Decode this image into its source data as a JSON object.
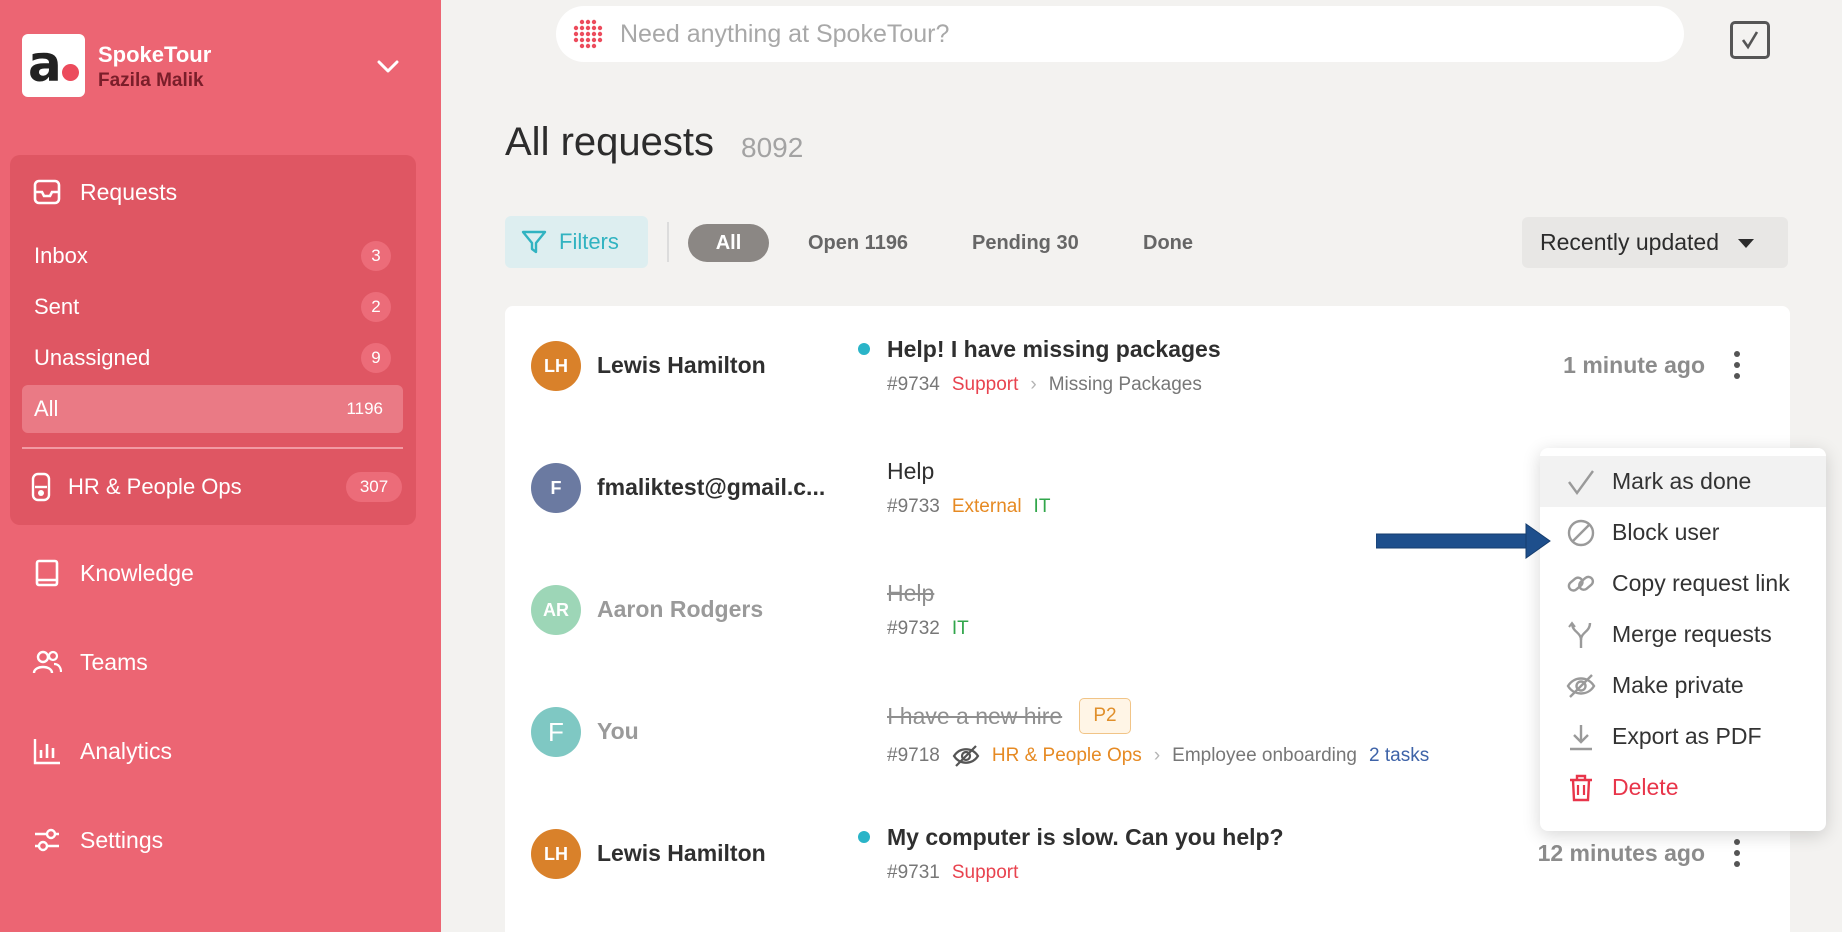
{
  "brand": {
    "name": "SpokeTour",
    "user": "Fazila Malik",
    "logo_letter": "a"
  },
  "sidebar": {
    "requests_label": "Requests",
    "items": [
      {
        "label": "Inbox",
        "count": "3"
      },
      {
        "label": "Sent",
        "count": "2"
      },
      {
        "label": "Unassigned",
        "count": "9"
      },
      {
        "label": "All",
        "count": "1196"
      }
    ],
    "team": {
      "label": "HR & People Ops",
      "count": "307"
    },
    "nav": [
      {
        "label": "Knowledge",
        "icon": "book-icon"
      },
      {
        "label": "Teams",
        "icon": "people-icon"
      },
      {
        "label": "Analytics",
        "icon": "bar-chart-icon"
      },
      {
        "label": "Settings",
        "icon": "sliders-icon"
      }
    ]
  },
  "search": {
    "placeholder": "Need anything at SpokeTour?"
  },
  "page": {
    "title": "All requests",
    "count": "8092"
  },
  "filters": {
    "button_label": "Filters",
    "tabs": [
      "All",
      "Open 1196",
      "Pending 30",
      "Done"
    ],
    "active_tab": "All",
    "sort_label": "Recently updated"
  },
  "requests": [
    {
      "initials": "LH",
      "avatar_color": "#d9812a",
      "requester": "Lewis Hamilton",
      "unread": true,
      "subject": "Help! I have missing packages",
      "id": "#9734",
      "tags": [
        "Support"
      ],
      "crumb": "Missing Packages",
      "time": "1 minute ago"
    },
    {
      "initials": "F",
      "avatar_color": "#6b7aa1",
      "requester": "fmaliktest@gmail.c...",
      "unread": false,
      "subject": "Help",
      "id": "#9733",
      "tags": [
        "External",
        "IT"
      ]
    },
    {
      "initials": "AR",
      "avatar_color": "#9dd6b7",
      "requester": "Aaron Rodgers",
      "unread": false,
      "subject": "Help",
      "id": "#9732",
      "tags": [
        "IT"
      ],
      "done": true
    },
    {
      "initials": "F",
      "avatar_color": "#7fc8c3",
      "requester": "You",
      "unread": false,
      "subject": "I have a new hire",
      "priority": "P2",
      "id": "#9718",
      "tags": [
        "HR & People Ops"
      ],
      "crumb": "Employee onboarding",
      "tasks": "2 tasks",
      "done": true
    },
    {
      "initials": "LH",
      "avatar_color": "#d9812a",
      "requester": "Lewis Hamilton",
      "unread": true,
      "subject": "My computer is slow. Can you help?",
      "id": "#9731",
      "tags": [
        "Support"
      ],
      "time": "12 minutes ago"
    }
  ],
  "context_menu": {
    "items": [
      {
        "label": "Mark as done",
        "icon": "check-icon"
      },
      {
        "label": "Block user",
        "icon": "block-icon"
      },
      {
        "label": "Copy request link",
        "icon": "link-icon"
      },
      {
        "label": "Merge requests",
        "icon": "merge-icon"
      },
      {
        "label": "Make private",
        "icon": "eye-off-icon"
      },
      {
        "label": "Export as PDF",
        "icon": "download-icon"
      },
      {
        "label": "Delete",
        "icon": "trash-icon"
      }
    ]
  },
  "colors": {
    "sidebar": "#ec6573",
    "accent": "#31b3c1",
    "danger": "#e8354a",
    "annotation_arrow": "#1e4f8c"
  }
}
